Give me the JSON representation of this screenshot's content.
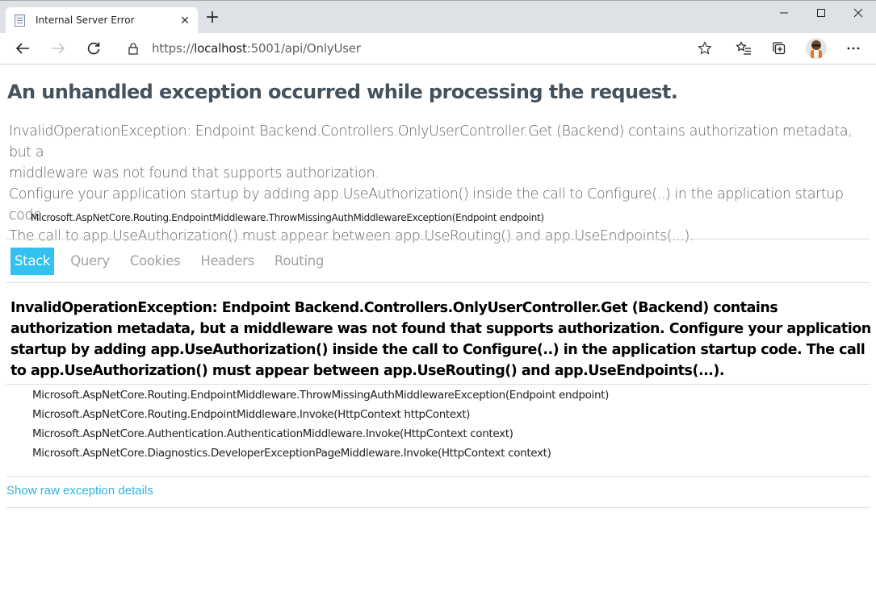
{
  "browser": {
    "tab_title": "Internal Server Error",
    "url_scheme": "https://",
    "url_host": "localhost",
    "url_rest": ":5001/api/OnlyUser"
  },
  "error": {
    "heading": "An unhandled exception occurred while processing the request.",
    "message_lines": [
      "InvalidOperationException: Endpoint Backend.Controllers.OnlyUserController.Get (Backend) contains authorization metadata, but a",
      "middleware was not found that supports authorization.",
      "Configure your application startup by adding app.UseAuthorization() inside the call to Configure(..) in the application startup code.",
      "The call to app.UseAuthorization() must appear between app.UseRouting() and app.UseEndpoints(...)."
    ],
    "location": "Microsoft.AspNetCore.Routing.EndpointMiddleware.ThrowMissingAuthMiddlewareException(Endpoint endpoint)"
  },
  "tabs": [
    "Stack",
    "Query",
    "Cookies",
    "Headers",
    "Routing"
  ],
  "stack": {
    "exception_header": "InvalidOperationException: Endpoint Backend.Controllers.OnlyUserController.Get (Backend) contains authorization metadata, but a middleware was not found that supports authorization. Configure your application startup by adding app.UseAuthorization() inside the call to Configure(..) in the application startup code. The call to app.UseAuthorization() must appear between app.UseRouting() and app.UseEndpoints(...).",
    "frames": [
      "Microsoft.AspNetCore.Routing.EndpointMiddleware.ThrowMissingAuthMiddlewareException(Endpoint endpoint)",
      "Microsoft.AspNetCore.Routing.EndpointMiddleware.Invoke(HttpContext httpContext)",
      "Microsoft.AspNetCore.Authentication.AuthenticationMiddleware.Invoke(HttpContext context)",
      "Microsoft.AspNetCore.Diagnostics.DeveloperExceptionPageMiddleware.Invoke(HttpContext context)"
    ],
    "raw_link": "Show raw exception details"
  },
  "colors": {
    "accent": "#33c2f0",
    "heading": "#44525e",
    "link": "#33b2e0"
  }
}
